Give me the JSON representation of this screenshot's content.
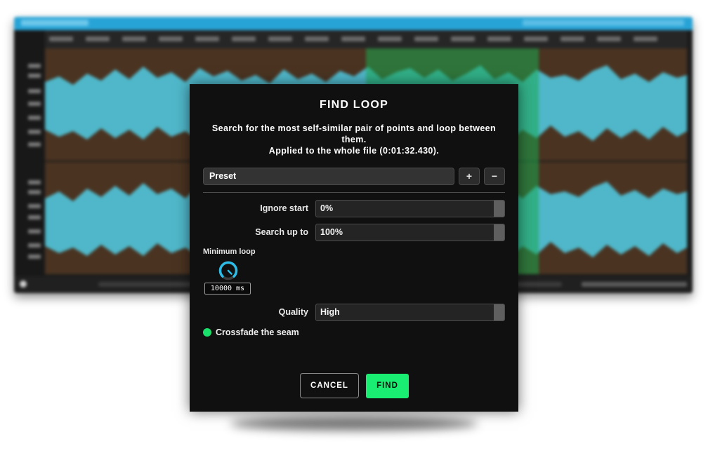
{
  "dialog": {
    "title": "FIND LOOP",
    "description_line1": "Search for the most self-similar pair of points and loop between them.",
    "description_line2": "Applied to the whole file (0:01:32.430).",
    "preset": {
      "label": "Preset",
      "add_label": "+",
      "remove_label": "−"
    },
    "ignore_start": {
      "label": "Ignore start",
      "value": "0%"
    },
    "search_up_to": {
      "label": "Search up to",
      "value": "100%"
    },
    "minimum_loop": {
      "label": "Minimum loop",
      "value": "10000 ms"
    },
    "quality": {
      "label": "Quality",
      "value": "High"
    },
    "crossfade": {
      "label": "Crossfade the seam",
      "checked": true
    },
    "buttons": {
      "cancel": "CANCEL",
      "find": "FIND"
    }
  },
  "colors": {
    "accent": "#19ee72",
    "knob": "#2bbde8",
    "titlebar": "#27a3d6",
    "waveform": "#4fb7c9",
    "waveform_bg": "#4a3321",
    "selection": "#1faa55"
  },
  "icons": {
    "preset_add": "plus-icon",
    "preset_remove": "minus-icon",
    "crossfade": "check-dot-icon",
    "minimum_loop": "knob-icon"
  }
}
